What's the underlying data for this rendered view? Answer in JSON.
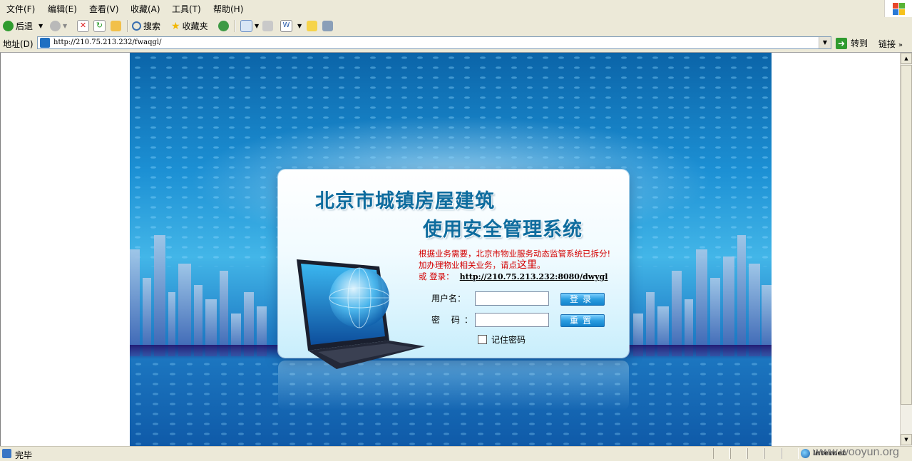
{
  "menu": {
    "items": [
      "文件(F)",
      "编辑(E)",
      "查看(V)",
      "收藏(A)",
      "工具(T)",
      "帮助(H)"
    ]
  },
  "toolbar": {
    "back_label": "后退",
    "search_label": "搜索",
    "favorites_label": "收藏夹"
  },
  "address_bar": {
    "label": "地址(D)",
    "url": "http://210.75.213.232/fwaqgl/",
    "go_label": "转到",
    "links_label": "链接"
  },
  "page": {
    "title_line1": "北京市城镇房屋建筑",
    "title_line2": "使用安全管理系统",
    "notice_line1": "根据业务需要，北京市物业服务动态监管系统已拆分!",
    "notice_line2_prefix": "加办理物业相关业务，请点",
    "notice_here_link": "这里",
    "notice_line2_suffix": "。",
    "notice_line3_prefix": "或 登录：",
    "notice_alt_url": "http://210.75.213.232:8080/dwygl",
    "username_label": "用户名：",
    "password_label": "密  码：",
    "login_button": "登录",
    "reset_button": "重置",
    "remember_label": "记住密码",
    "username_value": "",
    "password_value": ""
  },
  "status": {
    "text": "完毕",
    "zone": "Internet"
  },
  "watermark": "www.wooyun.org",
  "colors": {
    "title": "#0e6c9e",
    "notice": "#d40000",
    "button": "#1c90d4"
  }
}
